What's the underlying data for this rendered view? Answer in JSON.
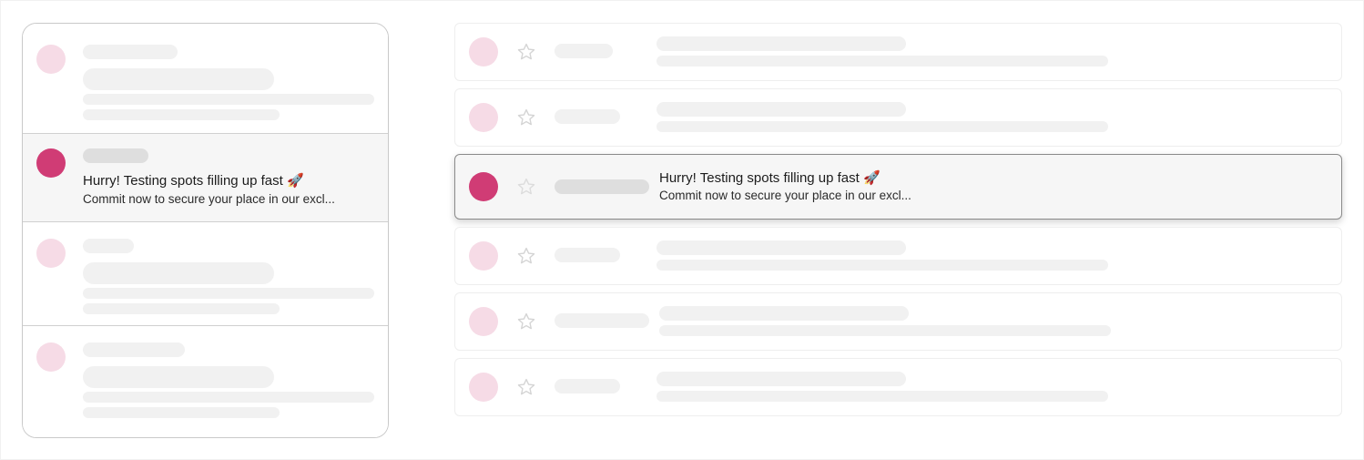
{
  "message": {
    "title": "Hurry! Testing spots filling up fast 🚀",
    "snippet": "Commit now to secure your place in our excl..."
  },
  "colors": {
    "accent": "#d03c75",
    "avatar_placeholder": "#f6dbe6",
    "skeleton": "#f1f1f1",
    "skeleton_dark": "#dedede",
    "active_background": "#f6f6f6"
  },
  "icons": {
    "star": "star-icon"
  }
}
